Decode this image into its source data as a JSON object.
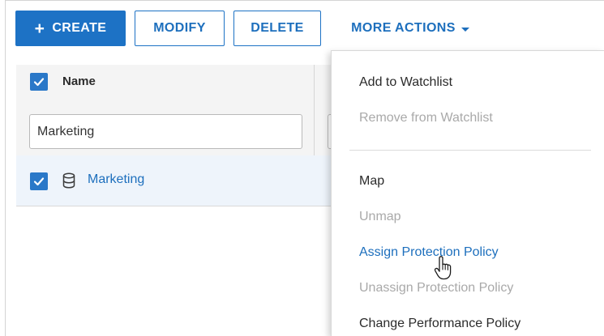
{
  "toolbar": {
    "create_label": "CREATE",
    "modify_label": "MODIFY",
    "delete_label": "DELETE",
    "more_actions_label": "MORE ACTIONS"
  },
  "table": {
    "column_name_header": "Name",
    "name_filter_value": "Marketing",
    "rows": [
      {
        "name": "Marketing",
        "selected": true,
        "icon": "database-icon"
      }
    ],
    "select_all_checked": true
  },
  "more_actions_menu": {
    "items": [
      {
        "label": "Add to Watchlist",
        "enabled": true
      },
      {
        "label": "Remove from Watchlist",
        "enabled": false
      },
      {
        "label": "Map",
        "enabled": true
      },
      {
        "label": "Unmap",
        "enabled": false
      },
      {
        "label": "Assign Protection Policy",
        "enabled": true,
        "hovered": true
      },
      {
        "label": "Unassign Protection Policy",
        "enabled": false
      },
      {
        "label": "Change Performance Policy",
        "enabled": true
      }
    ]
  },
  "colors": {
    "primary": "#1d72c5",
    "link": "#1d6fbd",
    "disabled_text": "#a9a9a9",
    "selected_row_bg": "#eef4fb"
  }
}
